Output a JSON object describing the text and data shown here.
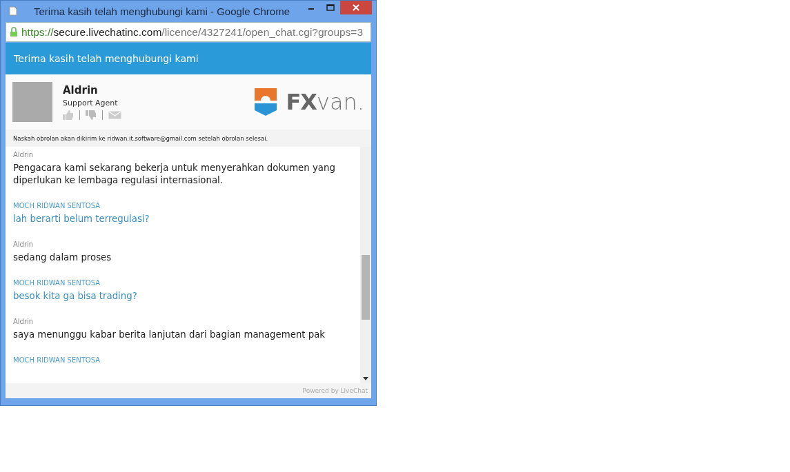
{
  "window": {
    "title": "Terima kasih telah menghubungi kami - Google Chrome"
  },
  "address_bar": {
    "scheme": "https://",
    "host": "secure.livechatinc.com",
    "path": "/licence/4327241/open_chat.cgi?groups=3"
  },
  "header": {
    "title": "Terima kasih telah menghubungi kami"
  },
  "agent": {
    "name": "Aldrin",
    "role": "Support Agent",
    "logo_text_bold": "FX",
    "logo_text": "van."
  },
  "notice": "Naskah obrolan akan dikirim ke ridwan.it.software@gmail.com setelah obrolan selesai.",
  "messages": [
    {
      "kind": "agent",
      "sender": "Aldrin",
      "text": "Pengacara kami sekarang bekerja untuk menyerahkan dokumen yang diperlukan ke lembaga regulasi internasional."
    },
    {
      "kind": "visitor",
      "sender": "MOCH RIDWAN SENTOSA",
      "text": "lah berarti belum terregulasi?"
    },
    {
      "kind": "agent",
      "sender": "Aldrin",
      "text": "sedang dalam proses"
    },
    {
      "kind": "visitor",
      "sender": "MOCH RIDWAN SENTOSA",
      "text": "besok kita ga bisa trading?"
    },
    {
      "kind": "agent",
      "sender": "Aldrin",
      "text": "saya menunggu kabar berita lanjutan dari bagian management pak"
    },
    {
      "kind": "visitor",
      "sender": "MOCH RIDWAN SENTOSA"
    }
  ],
  "footer": "Powered by LiveChat"
}
